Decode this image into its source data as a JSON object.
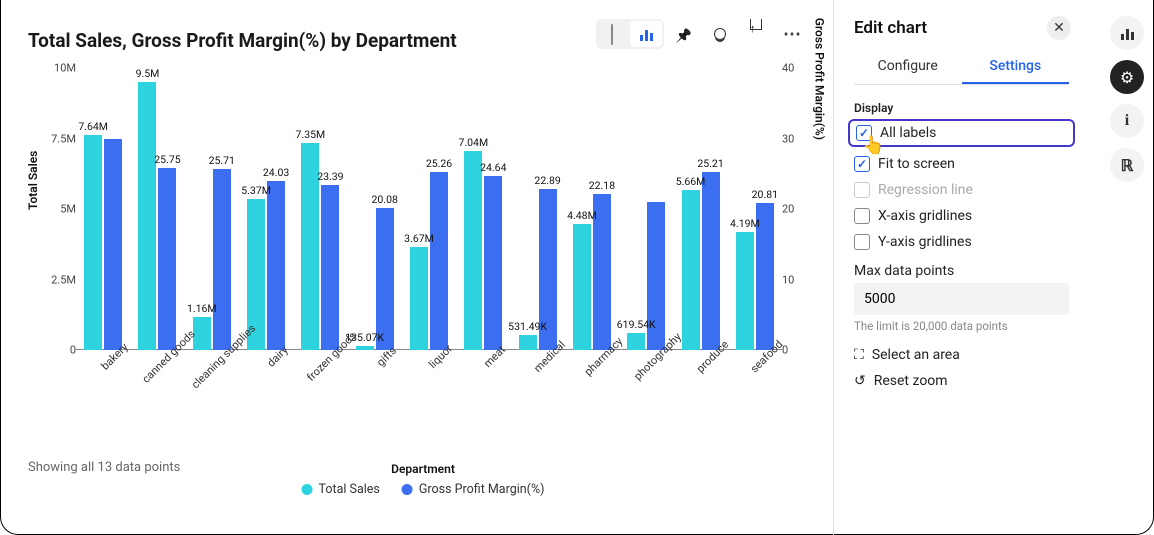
{
  "title": "Total Sales, Gross Profit Margin(%) by Department",
  "toolbar": {
    "table_icon": "table-icon",
    "bar_icon": "bar-chart-icon",
    "pin_icon": "pin-icon",
    "bulb_icon": "bulb-icon",
    "share_icon": "share-icon",
    "more_icon": "more-icon"
  },
  "y1_label": "Total Sales",
  "y2_label": "Gross Profit Margin(%)",
  "y1_ticks": [
    "0",
    "2.5M",
    "5M",
    "7.5M",
    "10M"
  ],
  "y2_ticks": [
    "0",
    "10",
    "20",
    "30",
    "40"
  ],
  "x_title": "Department",
  "dp_count_text": "Showing all 13 data points",
  "legend": {
    "s1": "Total Sales",
    "s2": "Gross Profit Margin(%)"
  },
  "panel": {
    "title": "Edit chart",
    "tabs": {
      "configure": "Configure",
      "settings": "Settings"
    },
    "section_display": "Display",
    "cb_all_labels": "All labels",
    "cb_fit": "Fit to screen",
    "cb_regression": "Regression line",
    "cb_xgrid": "X-axis gridlines",
    "cb_ygrid": "Y-axis gridlines",
    "max_dp_label": "Max data points",
    "max_dp_value": "5000",
    "max_dp_hint": "The limit is 20,000 data points",
    "select_area": "Select an area",
    "reset_zoom": "Reset zoom"
  },
  "chart_data": {
    "type": "bar",
    "title": "Total Sales, Gross Profit Margin(%) by Department",
    "categories": [
      "bakery",
      "canned goods",
      "cleaning supplies",
      "dairy",
      "frozen goods",
      "gifts",
      "liquor",
      "meat",
      "medical",
      "pharmacy",
      "photography",
      "produce",
      "seafood"
    ],
    "series": [
      {
        "name": "Total Sales",
        "axis": "left",
        "value_labels": [
          "7.64M",
          "9.5M",
          "1.16M",
          "5.37M",
          "7.35M",
          "135.07K",
          "3.67M",
          "7.04M",
          "531.49K",
          "4.48M",
          "619.54K",
          "5.66M",
          "4.19M"
        ],
        "values": [
          7640000,
          9500000,
          1160000,
          5370000,
          7350000,
          135070,
          3670000,
          7040000,
          531490,
          4480000,
          619540,
          5660000,
          4190000
        ]
      },
      {
        "name": "Gross Profit Margin(%)",
        "axis": "right",
        "value_labels": [
          "",
          "25.75",
          "25.71",
          "24.03",
          "23.39",
          "20.08",
          "25.26",
          "24.64",
          "22.89",
          "22.18",
          "",
          "25.21",
          "20.81"
        ],
        "values": [
          30,
          25.75,
          25.71,
          24.03,
          23.39,
          20.08,
          25.26,
          24.64,
          22.89,
          22.18,
          21,
          25.21,
          20.81
        ]
      }
    ],
    "xlabel": "Department",
    "ylabel_left": "Total Sales",
    "ylabel_right": "Gross Profit Margin(%)",
    "ylim_left": [
      0,
      10000000
    ],
    "ylim_right": [
      0,
      40
    ],
    "colors": {
      "Total Sales": "#2dd4e0",
      "Gross Profit Margin(%)": "#3b6ef0"
    }
  }
}
